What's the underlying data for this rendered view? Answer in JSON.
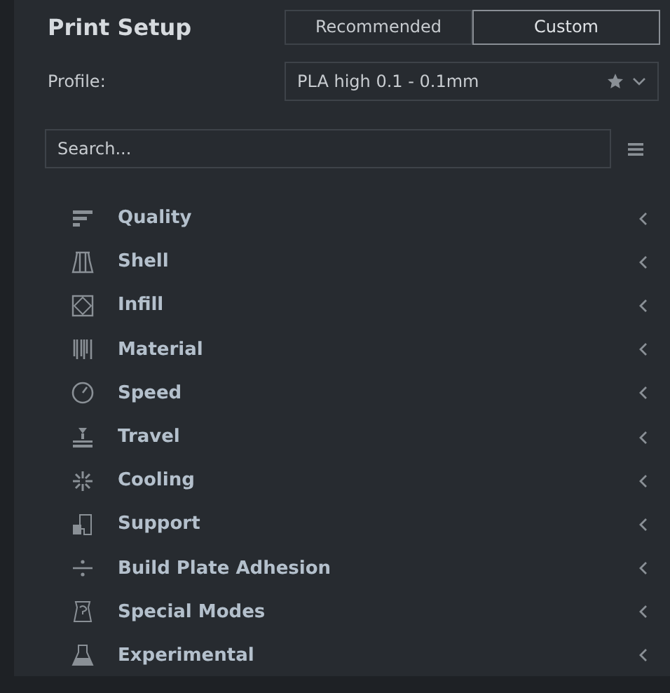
{
  "title": "Print Setup",
  "tabs": [
    {
      "label": "Recommended",
      "selected": false
    },
    {
      "label": "Custom",
      "selected": true
    }
  ],
  "profile": {
    "label": "Profile:",
    "value": "PLA high 0.1 - 0.1mm"
  },
  "search": {
    "placeholder": "Search..."
  },
  "categories": [
    {
      "label": "Quality"
    },
    {
      "label": "Shell"
    },
    {
      "label": "Infill"
    },
    {
      "label": "Material"
    },
    {
      "label": "Speed"
    },
    {
      "label": "Travel"
    },
    {
      "label": "Cooling"
    },
    {
      "label": "Support"
    },
    {
      "label": "Build Plate Adhesion"
    },
    {
      "label": "Special Modes"
    },
    {
      "label": "Experimental"
    }
  ]
}
